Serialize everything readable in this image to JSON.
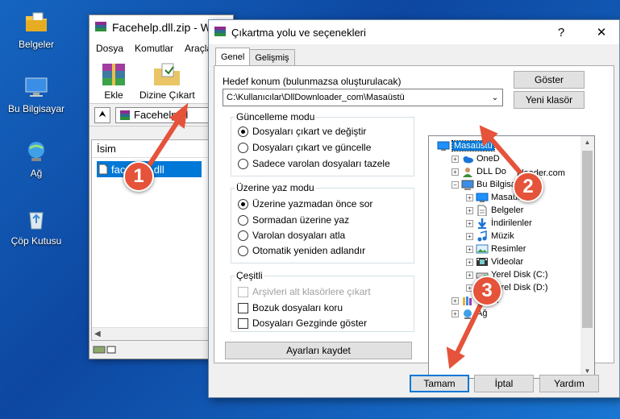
{
  "desktop": {
    "icons": [
      {
        "label": "Belgeler",
        "icon": "documents-folder-icon"
      },
      {
        "label": "Bu Bilgisayar",
        "icon": "computer-icon"
      },
      {
        "label": "Ağ",
        "icon": "network-icon"
      },
      {
        "label": "Çöp Kutusu",
        "icon": "recycle-bin-icon"
      }
    ]
  },
  "winrar": {
    "title": "Facehelp.dll.zip - W",
    "menu": [
      "Dosya",
      "Komutlar",
      "Araçla"
    ],
    "toolbar": {
      "add_label": "Ekle",
      "extract_label": "Dizine Çıkart"
    },
    "path": "Facehelp.dl",
    "column_name": "İsim",
    "file": "facehelp.dll"
  },
  "dialog": {
    "title": "Çıkartma yolu ve seçenekleri",
    "help_glyph": "?",
    "close_glyph": "✕",
    "tabs": [
      "Genel",
      "Gelişmiş"
    ],
    "dest_label": "Hedef konum (bulunmazsa oluşturulacak)",
    "dest_value": "C:\\Kullanıcılar\\DllDownloader_com\\Masaüstü",
    "show_button": "Göster",
    "new_folder_button": "Yeni klasör",
    "update_mode": {
      "title": "Güncelleme modu",
      "options": [
        "Dosyaları çıkart ve değiştir",
        "Dosyaları çıkart ve güncelle",
        "Sadece varolan dosyaları tazele"
      ],
      "selected": 0
    },
    "overwrite_mode": {
      "title": "Üzerine yaz modu",
      "options": [
        "Üzerine yazmadan önce sor",
        "Sormadan üzerine yaz",
        "Varolan dosyaları atla",
        "Otomatik yeniden adlandır"
      ],
      "selected": 0
    },
    "misc": {
      "title": "Çeşitli",
      "options": [
        {
          "label": "Arşivleri alt klasörlere çıkart",
          "checked": false,
          "disabled": true
        },
        {
          "label": "Bozuk dosyaları koru",
          "checked": false,
          "disabled": false
        },
        {
          "label": "Dosyaları Gezginde göster",
          "checked": false,
          "disabled": false
        }
      ]
    },
    "save_settings_button": "Ayarları kaydet",
    "tree": [
      {
        "label": "Masaüstü",
        "depth": 0,
        "exp": "",
        "icon": "desktop-icon",
        "selected": true
      },
      {
        "label": "OneD",
        "depth": 1,
        "exp": "+",
        "icon": "onedrive-icon",
        "selected": false
      },
      {
        "label": "DLL Do",
        "depth": 1,
        "exp": "+",
        "icon": "user-icon",
        "selected": false
      },
      {
        "label": "Bu Bilgisaya",
        "depth": 1,
        "exp": "−",
        "icon": "computer-icon",
        "selected": false
      },
      {
        "label": "Masaüstü",
        "depth": 2,
        "exp": "+",
        "icon": "desktop-icon",
        "selected": false
      },
      {
        "label": "Belgeler",
        "depth": 2,
        "exp": "+",
        "icon": "documents-icon",
        "selected": false
      },
      {
        "label": "İndirilenler",
        "depth": 2,
        "exp": "+",
        "icon": "downloads-icon",
        "selected": false
      },
      {
        "label": "Müzik",
        "depth": 2,
        "exp": "+",
        "icon": "music-icon",
        "selected": false
      },
      {
        "label": "Resimler",
        "depth": 2,
        "exp": "+",
        "icon": "pictures-icon",
        "selected": false
      },
      {
        "label": "Videolar",
        "depth": 2,
        "exp": "+",
        "icon": "videos-icon",
        "selected": false
      },
      {
        "label": "Yerel Disk (C:)",
        "depth": 2,
        "exp": "+",
        "icon": "drive-icon",
        "selected": false
      },
      {
        "label": "Yerel Disk (D:)",
        "depth": 2,
        "exp": "+",
        "icon": "drive-icon",
        "selected": false
      },
      {
        "label": "Kitapl",
        "depth": 1,
        "exp": "+",
        "icon": "libraries-icon",
        "selected": false
      },
      {
        "label": "Ağ",
        "depth": 1,
        "exp": "+",
        "icon": "network-icon",
        "selected": false
      }
    ],
    "tree_partial_text": "nloader.com",
    "ok_button": "Tamam",
    "cancel_button": "İptal",
    "help_button": "Yardım"
  },
  "markers": [
    "1",
    "2",
    "3"
  ],
  "colors": {
    "selection": "#0078d7",
    "marker": "#e5533a"
  }
}
